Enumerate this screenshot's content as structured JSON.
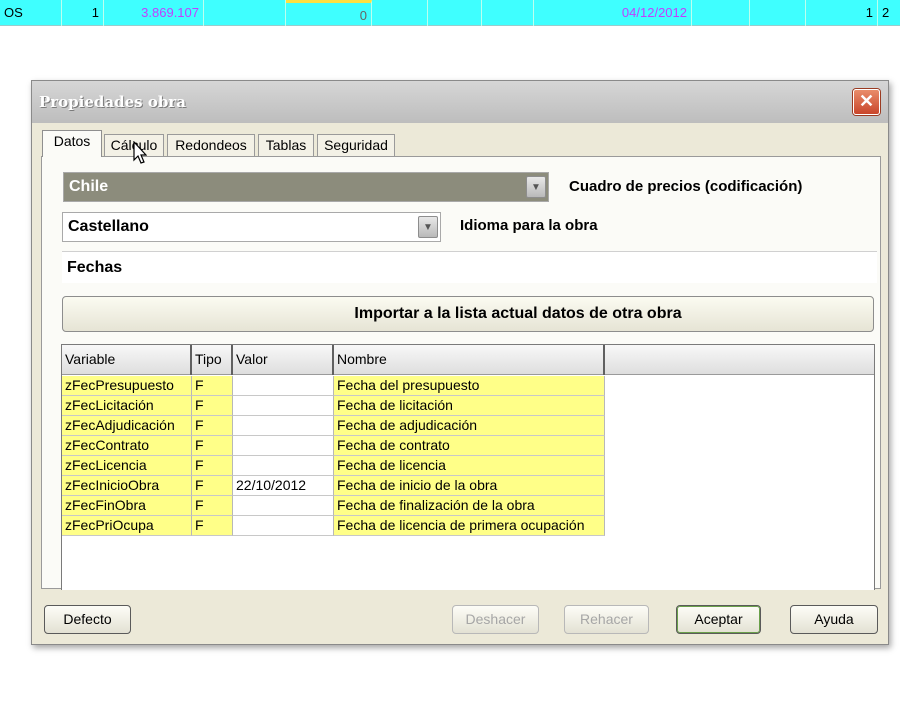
{
  "background_row": {
    "cells": [
      "OS",
      "1",
      "3.869.107",
      "",
      "0",
      "",
      "",
      "",
      "04/12/2012",
      "",
      "",
      "1",
      "2"
    ]
  },
  "dialog": {
    "title": "Propiedades obra",
    "close_glyph": "✕",
    "tabs": [
      "Datos",
      "Cálculo",
      "Redondeos",
      "Tablas",
      "Seguridad"
    ],
    "active_tab": "Datos",
    "price_combo": {
      "value": "Chile",
      "label": "Cuadro de precios (codificación)"
    },
    "language_combo": {
      "value": "Castellano",
      "label": "Idioma para la obra"
    },
    "dates_section": "Fechas",
    "import_button": "Importar a la lista actual datos de otra obra",
    "grid": {
      "headers": [
        "Variable",
        "Tipo",
        "Valor",
        "Nombre"
      ],
      "rows": [
        {
          "variable": "zFecPresupuesto",
          "tipo": "F",
          "valor": "",
          "nombre": "Fecha del presupuesto"
        },
        {
          "variable": "zFecLicitación",
          "tipo": "F",
          "valor": "",
          "nombre": "Fecha de licitación"
        },
        {
          "variable": "zFecAdjudicación",
          "tipo": "F",
          "valor": "",
          "nombre": "Fecha de adjudicación"
        },
        {
          "variable": "zFecContrato",
          "tipo": "F",
          "valor": "",
          "nombre": "Fecha de contrato"
        },
        {
          "variable": "zFecLicencia",
          "tipo": "F",
          "valor": "",
          "nombre": "Fecha de licencia"
        },
        {
          "variable": "zFecInicioObra",
          "tipo": "F",
          "valor": "22/10/2012",
          "nombre": "Fecha de inicio de la obra"
        },
        {
          "variable": "zFecFinObra",
          "tipo": "F",
          "valor": "",
          "nombre": "Fecha de finalización de la obra"
        },
        {
          "variable": "zFecPriOcupa",
          "tipo": "F",
          "valor": "",
          "nombre": "Fecha de licencia de primera ocupación"
        }
      ]
    },
    "buttons": {
      "defecto": "Defecto",
      "deshacer": "Deshacer",
      "rehacer": "Rehacer",
      "aceptar": "Aceptar",
      "ayuda": "Ayuda"
    }
  },
  "colors": {
    "cyan_row": "#3fffff",
    "grid_yellow": "#ffff88",
    "dark_combo": "#8c8c7c",
    "close_red": "#c9462b"
  },
  "icons": {
    "close": "close-icon",
    "combo_arrow": "chevron-down-icon",
    "cursor": "mouse-pointer-icon"
  }
}
